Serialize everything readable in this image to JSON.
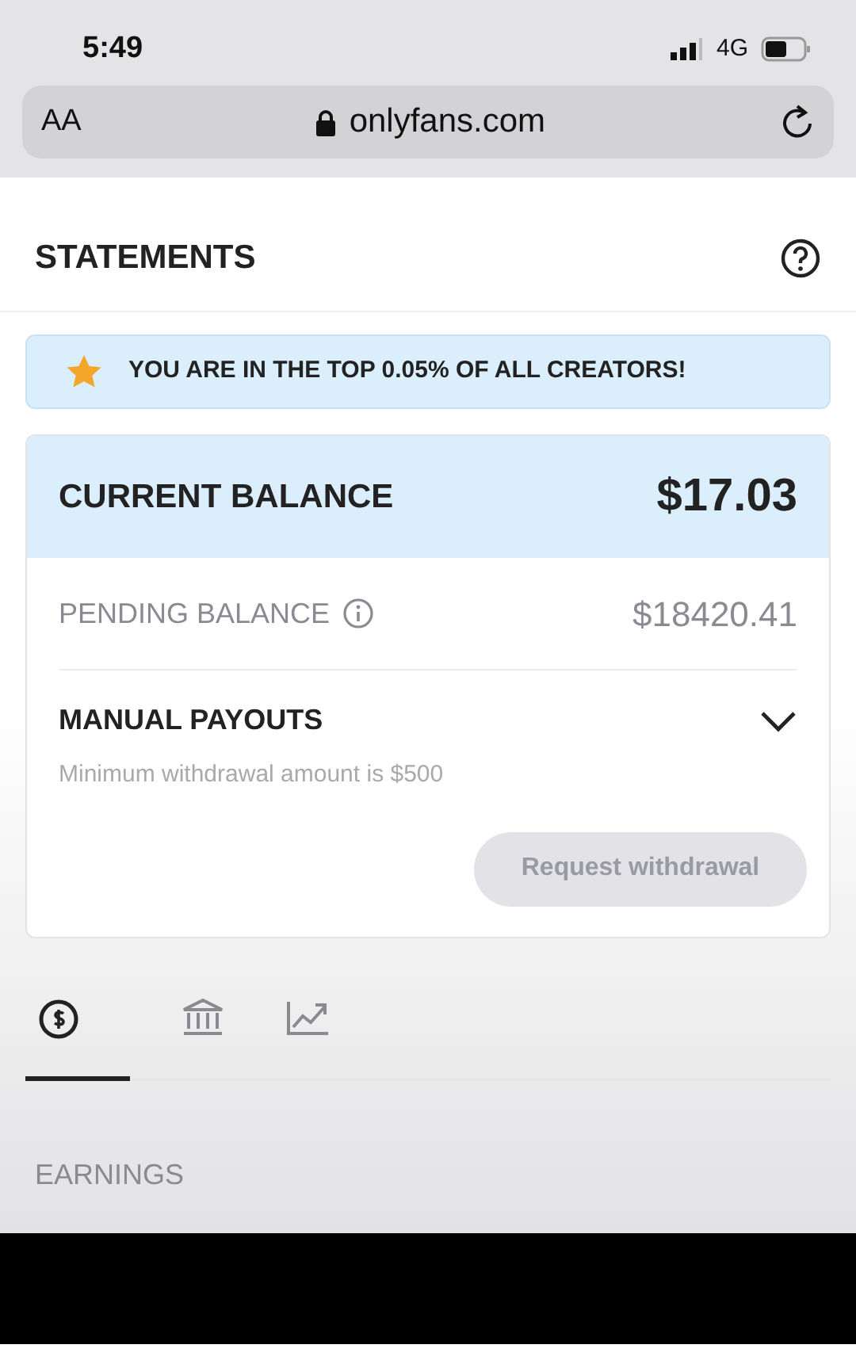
{
  "status_bar": {
    "time": "5:49",
    "network": "4G"
  },
  "browser": {
    "text_size": "AA",
    "url": "onlyfans.com"
  },
  "page": {
    "title": "STATEMENTS"
  },
  "banner": {
    "text": "YOU ARE IN THE TOP 0.05% OF ALL CREATORS!"
  },
  "current_balance": {
    "label": "CURRENT BALANCE",
    "amount": "$17.03"
  },
  "pending_balance": {
    "label": "PENDING BALANCE",
    "amount": "$18420.41"
  },
  "manual_payouts": {
    "title": "MANUAL PAYOUTS",
    "expanded": false,
    "note": "Minimum withdrawal amount is $500",
    "button": {
      "label": "Request withdrawal",
      "disabled": true
    }
  },
  "tabs": [
    {
      "kind": "earnings",
      "selected": true
    },
    {
      "kind": "bank",
      "selected": false
    },
    {
      "kind": "stats",
      "selected": false
    }
  ],
  "section": {
    "title": "EARNINGS"
  }
}
